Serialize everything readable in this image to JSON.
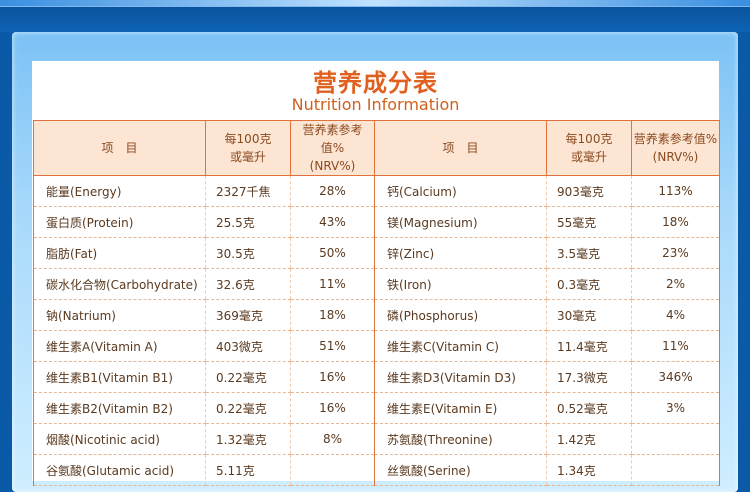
{
  "title_cn": "营养成分表",
  "title_en": "Nutrition Information",
  "headers": {
    "item": "项　目",
    "per100_l1": "每100克",
    "per100_l2": "或毫升",
    "nrv_l1": "营养素参考值%",
    "nrv_l2": "(NRV%)"
  },
  "rows": [
    {
      "l_name": "能量(Energy)",
      "l_amt": "2327千焦",
      "l_nrv": "28%",
      "r_name": "钙(Calcium)",
      "r_amt": "903毫克",
      "r_nrv": "113%"
    },
    {
      "l_name": "蛋白质(Protein)",
      "l_amt": "25.5克",
      "l_nrv": "43%",
      "r_name": "镁(Magnesium)",
      "r_amt": "55毫克",
      "r_nrv": "18%"
    },
    {
      "l_name": "脂肪(Fat)",
      "l_amt": "30.5克",
      "l_nrv": "50%",
      "r_name": "锌(Zinc)",
      "r_amt": "3.5毫克",
      "r_nrv": "23%"
    },
    {
      "l_name": "碳水化合物(Carbohydrate)",
      "l_amt": "32.6克",
      "l_nrv": "11%",
      "r_name": "铁(Iron)",
      "r_amt": "0.3毫克",
      "r_nrv": "2%"
    },
    {
      "l_name": "钠(Natrium)",
      "l_amt": "369毫克",
      "l_nrv": "18%",
      "r_name": "磷(Phosphorus)",
      "r_amt": "30毫克",
      "r_nrv": "4%"
    },
    {
      "l_name": "维生素A(Vitamin A)",
      "l_amt": "403微克",
      "l_nrv": "51%",
      "r_name": "维生素C(Vitamin C)",
      "r_amt": "11.4毫克",
      "r_nrv": "11%"
    },
    {
      "l_name": "维生素B1(Vitamin B1)",
      "l_amt": "0.22毫克",
      "l_nrv": "16%",
      "r_name": "维生素D3(Vitamin D3)",
      "r_amt": "17.3微克",
      "r_nrv": "346%"
    },
    {
      "l_name": "维生素B2(Vitamin B2)",
      "l_amt": "0.22毫克",
      "l_nrv": "16%",
      "r_name": "维生素E(Vitamin E)",
      "r_amt": "0.52毫克",
      "r_nrv": "3%"
    },
    {
      "l_name": "烟酸(Nicotinic acid)",
      "l_amt": "1.32毫克",
      "l_nrv": "8%",
      "r_name": "苏氨酸(Threonine)",
      "r_amt": "1.42克",
      "r_nrv": ""
    },
    {
      "l_name": "谷氨酸(Glutamic acid)",
      "l_amt": "5.11克",
      "l_nrv": "",
      "r_name": "丝氨酸(Serine)",
      "r_amt": "1.34克",
      "r_nrv": ""
    }
  ],
  "colors": {
    "title": "#e0611f",
    "border": "#e0733a",
    "header_bg": "#fde5d3",
    "page_bg": "#0b5aa8"
  }
}
